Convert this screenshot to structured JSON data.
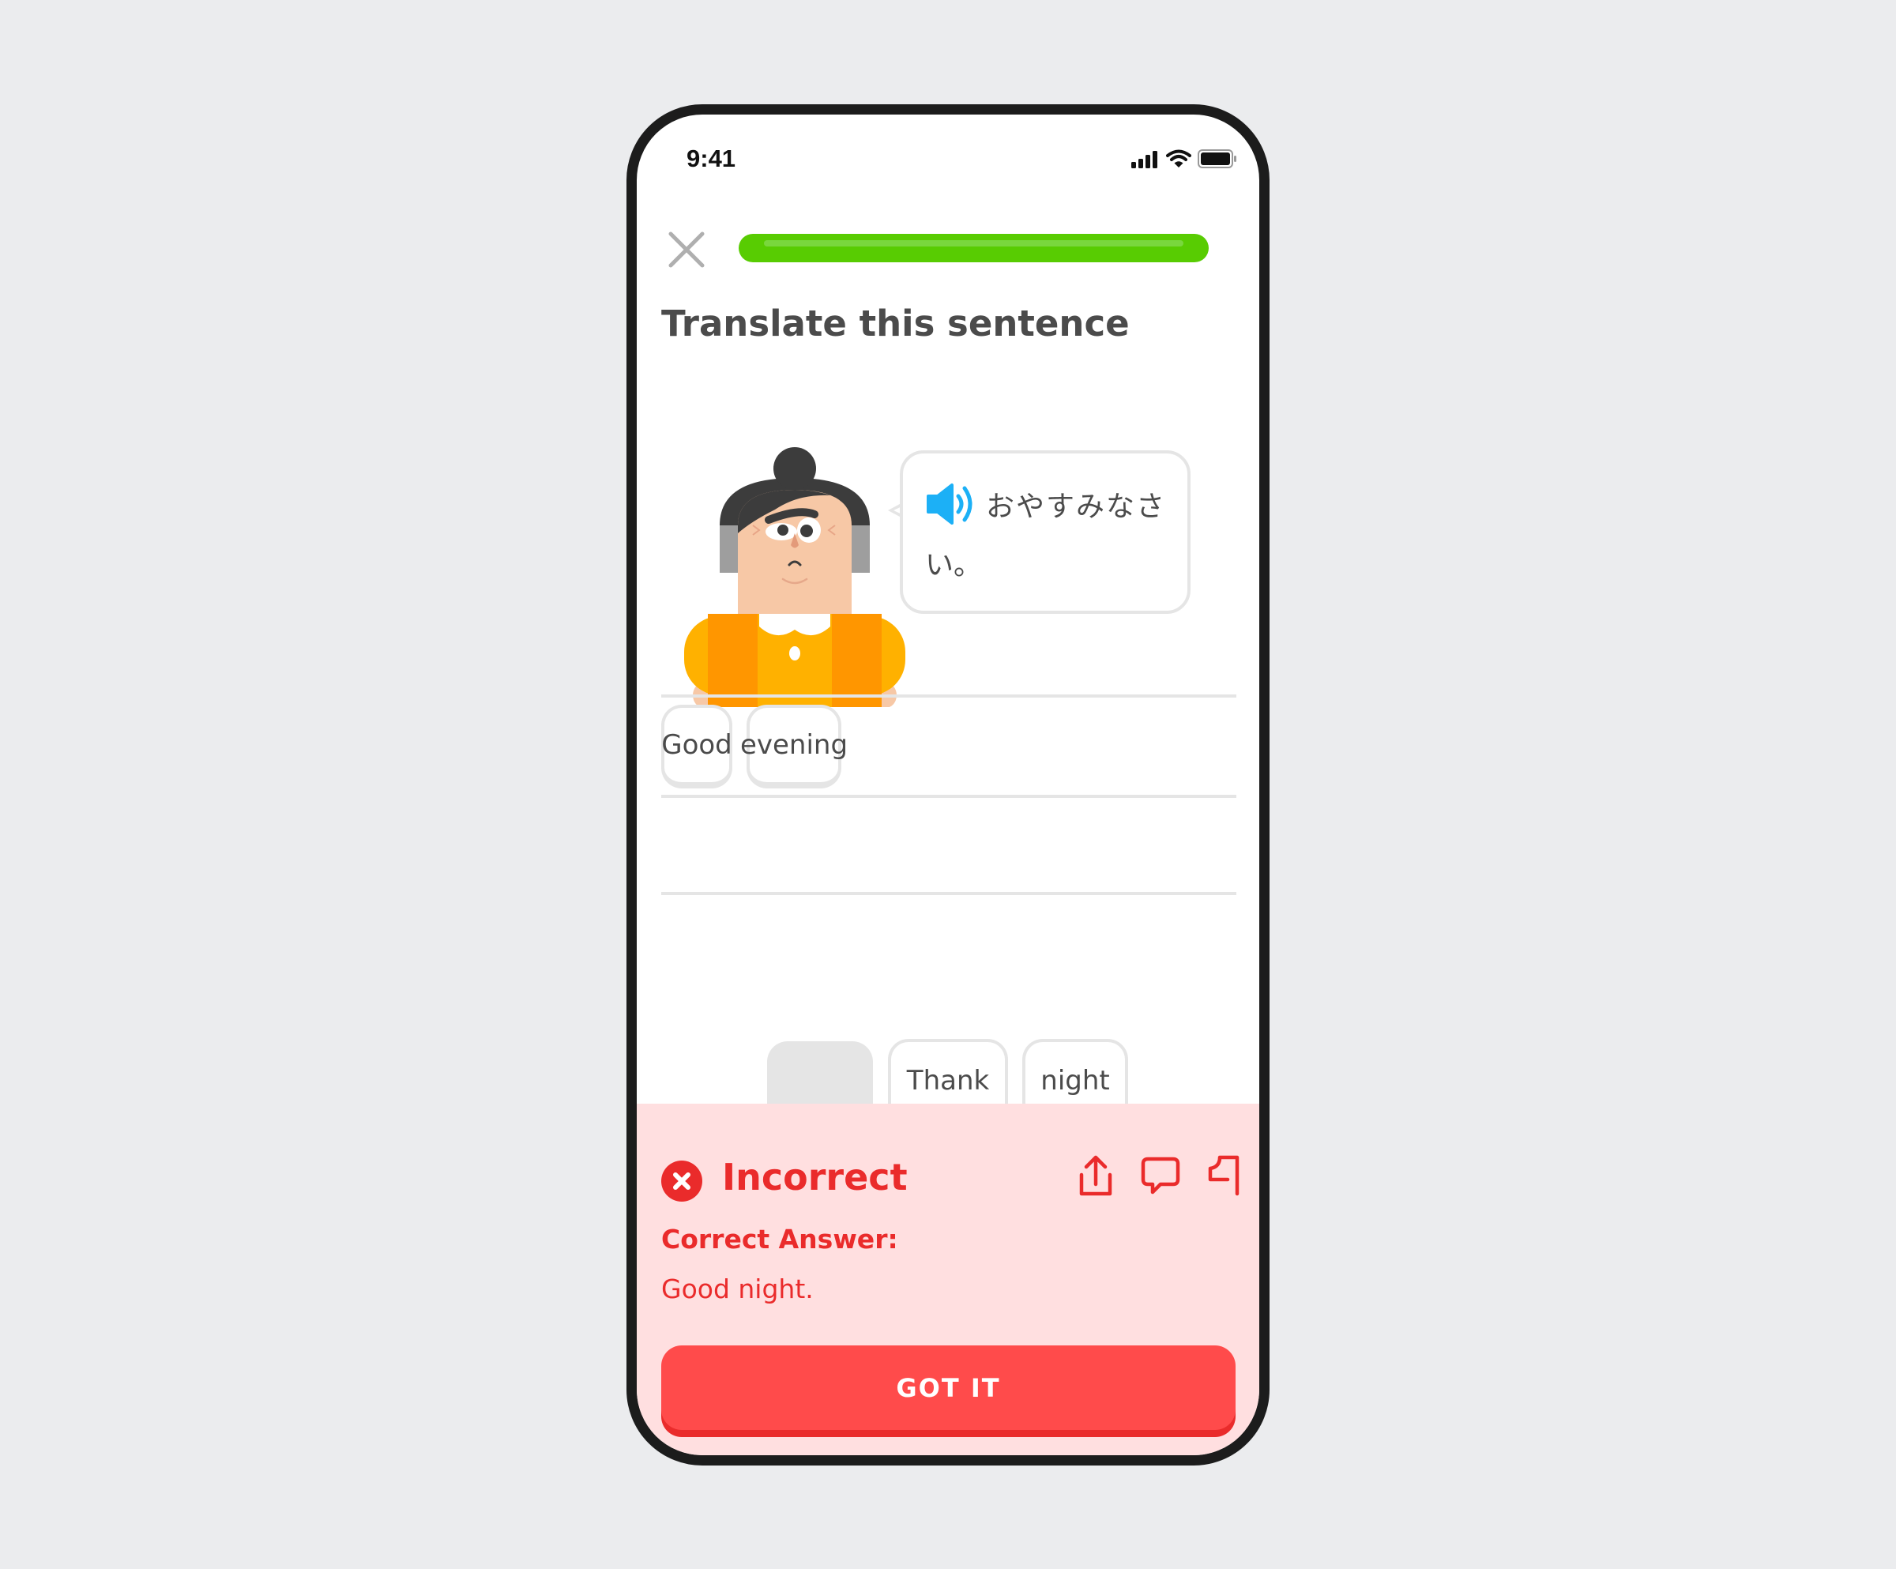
{
  "status_bar": {
    "time": "9:41",
    "icons": [
      "signal-icon",
      "wifi-icon",
      "battery-icon"
    ]
  },
  "header": {
    "close_icon": "close-icon",
    "progress": 1.0,
    "progress_color": "#58cc02"
  },
  "exercise": {
    "instruction": "Translate this sentence",
    "prompt_line1": "おやすみなさ",
    "prompt_line2": "い。",
    "speaker_icon": "speaker-icon"
  },
  "answer_area": {
    "selected_words": [
      "Good",
      "evening"
    ]
  },
  "word_bank": {
    "words": [
      {
        "label": "",
        "used": true
      },
      {
        "label": "Thank",
        "used": false
      },
      {
        "label": "night",
        "used": false
      }
    ]
  },
  "feedback": {
    "status": "Incorrect",
    "status_icon": "error-x-icon",
    "correct_answer_label": "Correct Answer:",
    "correct_answer": "Good night.",
    "actions": [
      "share-icon",
      "comment-icon",
      "flag-icon"
    ],
    "button_label": "GOT IT",
    "accent_color": "#ea2b2b",
    "button_color": "#ff4b4b",
    "background_color": "#ffdfe0"
  }
}
